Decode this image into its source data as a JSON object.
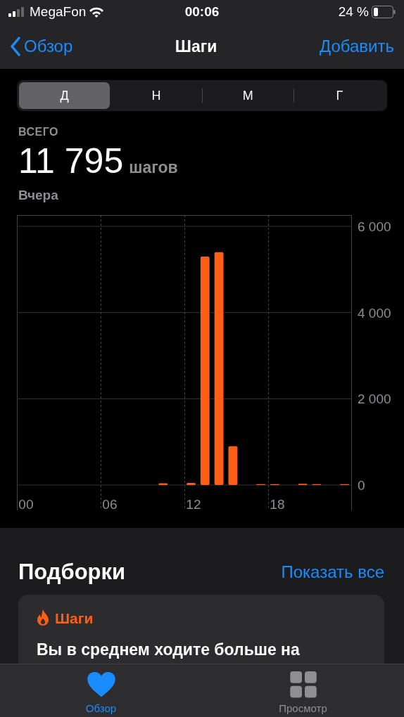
{
  "status_bar": {
    "carrier": "MegaFon",
    "time": "00:06",
    "battery": "24 %"
  },
  "nav": {
    "back": "Обзор",
    "title": "Шаги",
    "action": "Добавить"
  },
  "periods": [
    {
      "label": "Д",
      "selected": true
    },
    {
      "label": "Н",
      "selected": false
    },
    {
      "label": "М",
      "selected": false
    },
    {
      "label": "Г",
      "selected": false
    }
  ],
  "summary": {
    "caption": "ВСЕГО",
    "value": "11 795",
    "unit": "шагов",
    "date": "Вчера"
  },
  "chart_data": {
    "type": "bar",
    "x": [
      0,
      1,
      2,
      3,
      4,
      5,
      6,
      7,
      8,
      9,
      10,
      11,
      12,
      13,
      14,
      15,
      16,
      17,
      18,
      19,
      20,
      21,
      22,
      23
    ],
    "xlim": [
      -0.5,
      23.5
    ],
    "series": [
      {
        "color": "#ff5f15",
        "values": [
          0,
          0,
          0,
          0,
          0,
          0,
          0,
          0,
          0,
          0,
          40,
          0,
          50,
          5300,
          5400,
          900,
          0,
          20,
          20,
          0,
          30,
          20,
          0,
          20
        ]
      }
    ],
    "ylim": [
      0,
      6000
    ],
    "yticks": [
      {
        "value": 0,
        "label": "0"
      },
      {
        "value": 2000,
        "label": "2 000"
      },
      {
        "value": 4000,
        "label": "4 000"
      },
      {
        "value": 6000,
        "label": "6 000"
      }
    ],
    "xticks": [
      {
        "value": 0,
        "label": "00"
      },
      {
        "value": 6,
        "label": "06"
      },
      {
        "value": 12,
        "label": "12"
      },
      {
        "value": 18,
        "label": "18"
      }
    ]
  },
  "highlights": {
    "title": "Подборки",
    "show_all": "Показать все",
    "card": {
      "category": "Шаги",
      "text": "Вы в среднем ходите больше на"
    }
  },
  "tabs": [
    {
      "label": "Обзор",
      "kind": "heart",
      "selected": true
    },
    {
      "label": "Просмотр",
      "kind": "grid",
      "selected": false
    }
  ]
}
